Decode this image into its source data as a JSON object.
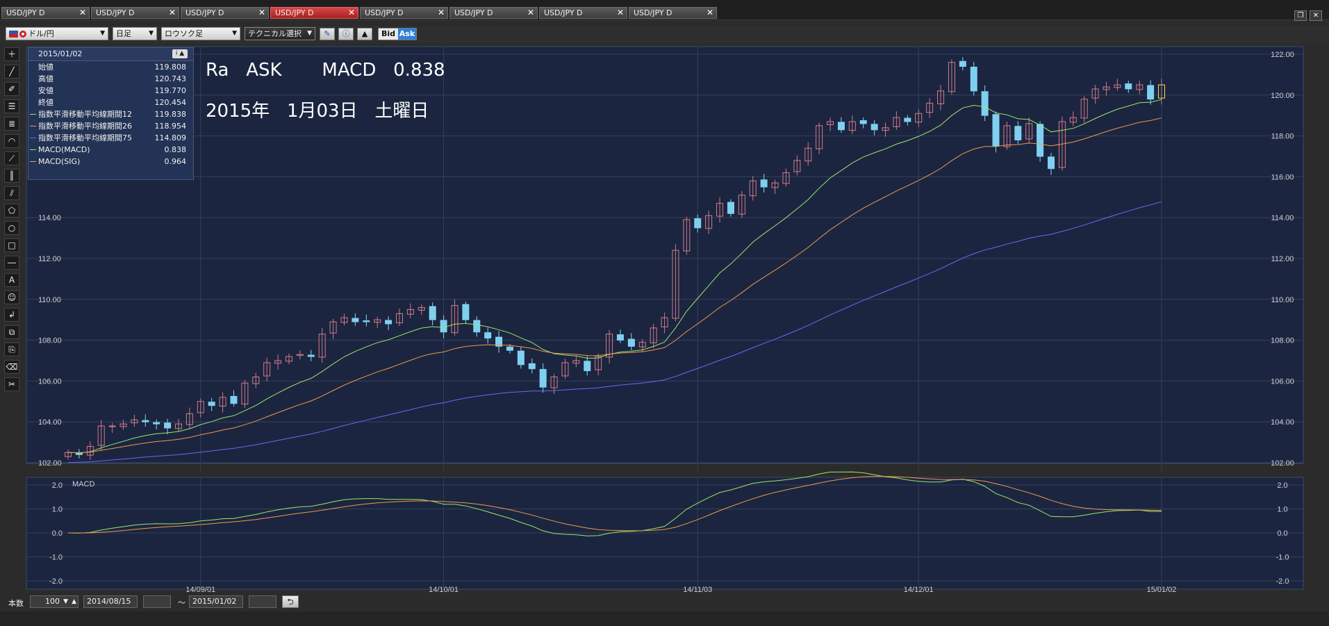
{
  "tabs": [
    {
      "label": "USD/JPY D",
      "active": false
    },
    {
      "label": "USD/JPY D",
      "active": false
    },
    {
      "label": "USD/JPY D",
      "active": false
    },
    {
      "label": "USD/JPY D",
      "active": true
    },
    {
      "label": "USD/JPY D",
      "active": false
    },
    {
      "label": "USD/JPY D",
      "active": false
    },
    {
      "label": "USD/JPY D",
      "active": false
    },
    {
      "label": "USD/JPY D",
      "active": false
    }
  ],
  "toolbar": {
    "currency": "ドル/円",
    "period": "日足",
    "chart_type": "ロウソク足",
    "technical": "テクニカル選択",
    "bid": "Bid",
    "ask": "Ask"
  },
  "info": {
    "date": "2015/01/02",
    "rows": [
      {
        "label": "始値",
        "value": "119.808",
        "color": ""
      },
      {
        "label": "高値",
        "value": "120.743",
        "color": ""
      },
      {
        "label": "安値",
        "value": "119.770",
        "color": ""
      },
      {
        "label": "終値",
        "value": "120.454",
        "color": ""
      },
      {
        "label": "指数平滑移動平均線期間12",
        "value": "119.838",
        "color": "#9be86a"
      },
      {
        "label": "指数平滑移動平均線期間26",
        "value": "118.954",
        "color": "#f09a4a"
      },
      {
        "label": "指数平滑移動平均線期間75",
        "value": "114.809",
        "color": "#6a6aef"
      },
      {
        "label": "MACD(MACD)",
        "value": "0.838",
        "color": "#9be86a"
      },
      {
        "label": "MACD(SIG)",
        "value": "0.964",
        "color": "#f09a4a"
      }
    ]
  },
  "overlay": {
    "line1": "Ra   ASK       MACD   0.838",
    "line2": "2015年   1月03日   土曜日"
  },
  "bottom": {
    "count_label": "本数",
    "count_value": "100",
    "from_date": "2014/08/15",
    "tilde": "～",
    "to_date": "2015/01/02"
  },
  "chart_data": {
    "type": "candlestick",
    "main": {
      "ylim": [
        102,
        122
      ],
      "yticks": [
        "102.00",
        "104.00",
        "106.00",
        "108.00",
        "110.00",
        "112.00",
        "114.00",
        "116.00",
        "118.00",
        "120.00",
        "122.00"
      ],
      "xticks": [
        "14/09/01",
        "14/10/01",
        "14/11/03",
        "14/12/01",
        "15/01/02"
      ],
      "candle_up_color": "#d87a8a",
      "candle_down_color": "#7fd0f0",
      "close": [
        102.5,
        102.4,
        102.8,
        103.8,
        103.8,
        103.9,
        104.1,
        104.0,
        103.9,
        103.7,
        103.9,
        104.4,
        105.0,
        104.8,
        105.2,
        104.9,
        105.9,
        106.2,
        106.9,
        107.0,
        107.2,
        107.3,
        107.2,
        108.3,
        108.9,
        109.1,
        108.9,
        108.9,
        109.0,
        108.8,
        109.3,
        109.5,
        109.6,
        109.0,
        108.4,
        109.7,
        109.0,
        108.4,
        108.1,
        107.7,
        107.5,
        106.8,
        106.6,
        105.7,
        106.2,
        106.9,
        107.0,
        106.5,
        107.2,
        108.3,
        108.0,
        107.7,
        107.9,
        108.6,
        109.1,
        112.4,
        113.9,
        113.5,
        114.1,
        114.7,
        114.2,
        115.1,
        115.8,
        115.5,
        115.7,
        116.2,
        116.8,
        117.4,
        118.5,
        118.7,
        118.3,
        118.7,
        118.6,
        118.3,
        118.4,
        118.9,
        118.7,
        119.1,
        119.6,
        120.2,
        121.6,
        121.4,
        120.2,
        119.0,
        117.5,
        118.5,
        117.8,
        118.6,
        117.0,
        116.4,
        118.7,
        118.9,
        119.8,
        120.3,
        120.4,
        120.5,
        120.3,
        120.5,
        119.8,
        120.5
      ],
      "ema_series": [
        "ema12",
        "ema26",
        "ema75"
      ]
    },
    "macd": {
      "label": "MACD",
      "ylim": [
        -2.0,
        2.0
      ],
      "yticks": [
        "2.0",
        "1.0",
        "0.0",
        "-1.0",
        "-2.0"
      ],
      "macd_last": 0.838,
      "sig_last": 0.964
    }
  }
}
